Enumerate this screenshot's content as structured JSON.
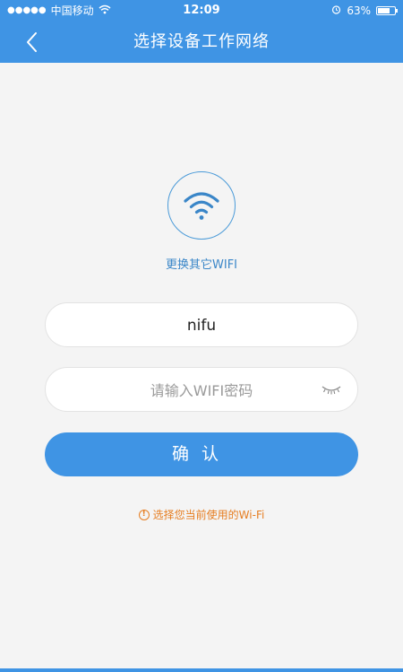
{
  "status_bar": {
    "signal_dots": "●●●●●",
    "carrier": "中国移动",
    "time": "12:09",
    "battery": "63%"
  },
  "nav": {
    "title": "选择设备工作网络",
    "back_icon": "chevron-left-icon"
  },
  "wifi": {
    "icon": "wifi-icon",
    "change_label": "更换其它WIFI"
  },
  "form": {
    "ssid_value": "nifu",
    "password_placeholder": "请输入WIFI密码",
    "toggle_icon": "eye-closed-icon"
  },
  "confirm_label": "确认",
  "hint": {
    "icon": "warning-icon",
    "text": "选择您当前使用的Wi-Fi"
  },
  "colors": {
    "accent": "#3f94e4",
    "hint": "#e67e22",
    "background": "#f4f4f4"
  }
}
